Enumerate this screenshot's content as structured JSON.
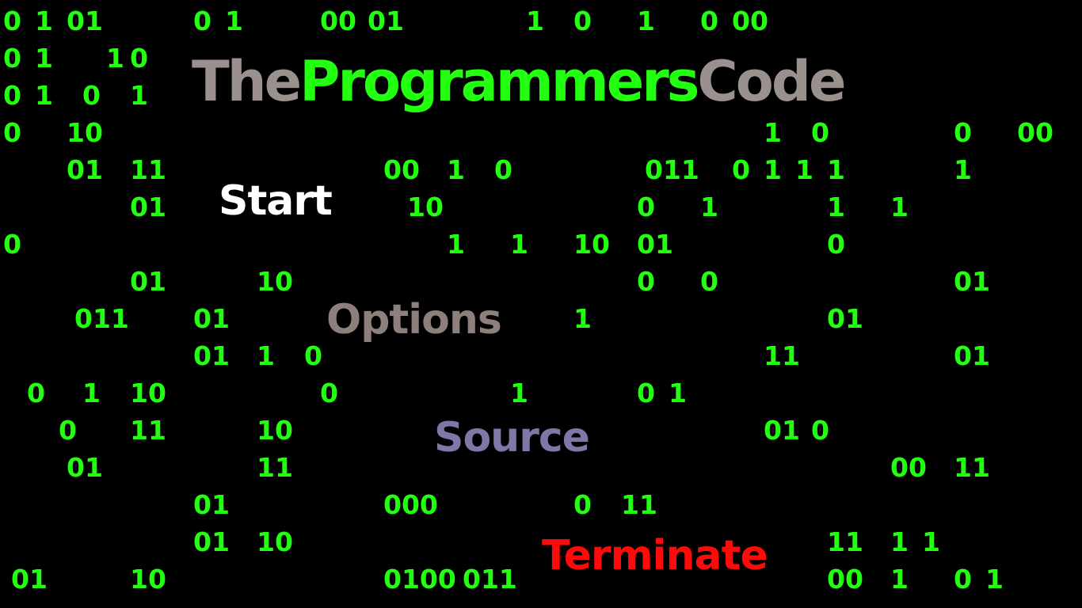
{
  "title": {
    "part1": "The",
    "part2": "Programmers",
    "part3": "Code",
    "color1": "#9a908e",
    "color2": "#22ff11",
    "color3": "#9a908e"
  },
  "menu": {
    "items": [
      {
        "label": "Start",
        "color": "#ffffff"
      },
      {
        "label": "Options",
        "color": "#8c7f7c"
      },
      {
        "label": "Source",
        "color": "#8077a8"
      },
      {
        "label": "Terminate",
        "color": "#ff0a0a"
      }
    ]
  },
  "binary_color": "#22ff11",
  "background_rain": [
    {
      "row": 0,
      "cells": [
        [
          "0",
          0
        ],
        [
          "1",
          2
        ],
        [
          "01",
          4
        ],
        [
          "0",
          12
        ],
        [
          "1",
          14
        ],
        [
          "00",
          20
        ],
        [
          "01",
          23
        ],
        [
          "1",
          33
        ],
        [
          "0",
          36
        ],
        [
          "1",
          40
        ],
        [
          "0",
          44
        ],
        [
          "00",
          46
        ]
      ]
    },
    {
      "row": 1,
      "cells": [
        [
          "0",
          0
        ],
        [
          "1",
          2
        ],
        [
          "1",
          6.5
        ],
        [
          "0",
          8
        ]
      ]
    },
    {
      "row": 2,
      "cells": [
        [
          "0",
          0
        ],
        [
          "1",
          2
        ],
        [
          "0",
          5
        ],
        [
          "1",
          8
        ]
      ]
    },
    {
      "row": 3,
      "cells": [
        [
          "0",
          0
        ],
        [
          "10",
          4
        ],
        [
          "1",
          48
        ],
        [
          "0",
          51
        ],
        [
          "0",
          60
        ],
        [
          "00",
          64
        ]
      ]
    },
    {
      "row": 4,
      "cells": [
        [
          "01",
          4
        ],
        [
          "11",
          8
        ],
        [
          "00",
          24
        ],
        [
          "1",
          28
        ],
        [
          "0",
          31
        ],
        [
          "011",
          40.5
        ],
        [
          "0",
          46
        ],
        [
          "1",
          48
        ],
        [
          "1",
          50
        ],
        [
          "1",
          52
        ],
        [
          "1",
          60
        ]
      ]
    },
    {
      "row": 5,
      "cells": [
        [
          "01",
          8
        ],
        [
          "10",
          25.5
        ],
        [
          "0",
          40
        ],
        [
          "1",
          44
        ],
        [
          "1",
          52
        ],
        [
          "1",
          56
        ]
      ]
    },
    {
      "row": 6,
      "cells": [
        [
          "0",
          0
        ],
        [
          "1",
          28
        ],
        [
          "1",
          32
        ],
        [
          "10",
          36
        ],
        [
          "01",
          40
        ],
        [
          "0",
          52
        ]
      ]
    },
    {
      "row": 7,
      "cells": [
        [
          "01",
          8
        ],
        [
          "10",
          16
        ],
        [
          "0",
          40
        ],
        [
          "0",
          44
        ],
        [
          "01",
          60
        ]
      ]
    },
    {
      "row": 8,
      "cells": [
        [
          "011",
          4.5
        ],
        [
          "01",
          12
        ],
        [
          "1",
          36
        ],
        [
          "01",
          52
        ]
      ]
    },
    {
      "row": 9,
      "cells": [
        [
          "01",
          12
        ],
        [
          "1",
          16
        ],
        [
          "0",
          19
        ],
        [
          "11",
          48
        ],
        [
          "01",
          60
        ]
      ]
    },
    {
      "row": 10,
      "cells": [
        [
          "0",
          1.5
        ],
        [
          "1",
          5
        ],
        [
          "10",
          8
        ],
        [
          "0",
          20
        ],
        [
          "1",
          32
        ],
        [
          "0",
          40
        ],
        [
          "1",
          42
        ]
      ]
    },
    {
      "row": 11,
      "cells": [
        [
          "0",
          3.5
        ],
        [
          "11",
          8
        ],
        [
          "10",
          16
        ],
        [
          "01",
          48
        ],
        [
          "0",
          51
        ]
      ]
    },
    {
      "row": 12,
      "cells": [
        [
          "01",
          4
        ],
        [
          "11",
          16
        ],
        [
          "00",
          56
        ],
        [
          "11",
          60
        ]
      ]
    },
    {
      "row": 13,
      "cells": [
        [
          "01",
          12
        ],
        [
          "000",
          24
        ],
        [
          "0",
          36
        ],
        [
          "11",
          39
        ]
      ]
    },
    {
      "row": 14,
      "cells": [
        [
          "01",
          12
        ],
        [
          "10",
          16
        ],
        [
          "11",
          52
        ],
        [
          "1",
          56
        ],
        [
          "1",
          58
        ]
      ]
    },
    {
      "row": 15,
      "cells": [
        [
          "01",
          0.5
        ],
        [
          "10",
          8
        ],
        [
          "0100",
          24
        ],
        [
          "011",
          29
        ],
        [
          "00",
          52
        ],
        [
          "1",
          56
        ],
        [
          "0",
          60
        ],
        [
          "1",
          62
        ]
      ]
    }
  ]
}
